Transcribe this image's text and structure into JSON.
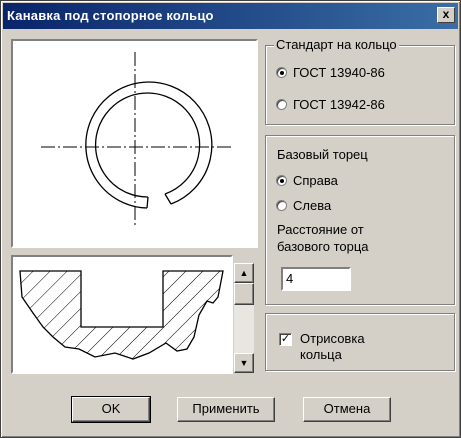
{
  "window": {
    "title": "Канавка под стопорное кольцо",
    "close_symbol": "x"
  },
  "standard_group": {
    "legend": "Стандарт на кольцо",
    "options": [
      {
        "label": "ГОСТ 13940-86",
        "selected": true
      },
      {
        "label": "ГОСТ 13942-86",
        "selected": false
      }
    ]
  },
  "base_group": {
    "title": "Базовый торец",
    "options": [
      {
        "label": "Справа",
        "selected": true
      },
      {
        "label": "Слева",
        "selected": false
      }
    ],
    "distance_label_line1": "Расстояние от",
    "distance_label_line2": "базового торца",
    "distance_value": "4"
  },
  "draw_ring": {
    "label_line1": "Отрисовка",
    "label_line2": "кольца",
    "checked": true
  },
  "buttons": {
    "ok": "OK",
    "apply": "Применить",
    "cancel": "Отмена"
  },
  "icons": {
    "scroll_up": "triangle-up-icon",
    "scroll_down": "triangle-down-icon",
    "check": "check-icon"
  }
}
